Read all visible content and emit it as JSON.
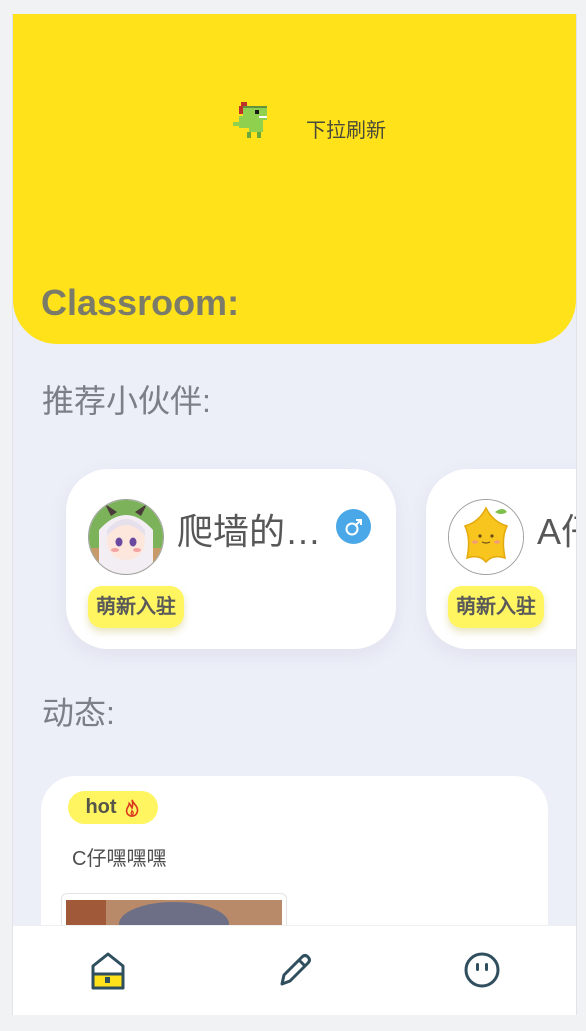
{
  "header": {
    "refresh_hint": "下拉刷新",
    "title": "Classroom:"
  },
  "sections": {
    "recommend_title": "推荐小伙伴:",
    "moments_title": "动态:"
  },
  "partners": [
    {
      "name": "爬墙的…",
      "tag": "萌新入驻",
      "gender_icon": "male-icon",
      "avatar_icon": "anime-girl-avatar"
    },
    {
      "name": "A仔",
      "tag": "萌新入驻",
      "avatar_icon": "yellow-star-mascot-avatar"
    }
  ],
  "post": {
    "badge": "hot",
    "badge_icon": "flame-icon",
    "author": "C仔嘿嘿嘿"
  },
  "tabbar": {
    "items": [
      "home-icon",
      "edit-icon",
      "profile-icon"
    ]
  },
  "colors": {
    "accent_yellow": "#ffe21a",
    "tag_yellow": "#fff560",
    "male_blue": "#4aa8e8",
    "icon_dark": "#2f4f5e"
  }
}
